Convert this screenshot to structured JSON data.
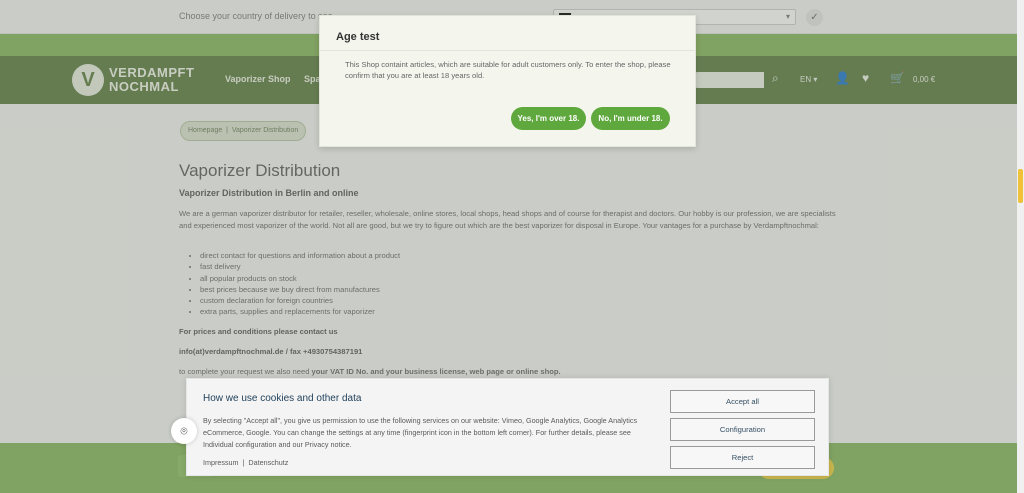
{
  "country_bar": {
    "text": "Choose your country of delivery to see",
    "confirm_icon": "check-icon"
  },
  "header": {
    "logo_text_1": "VERDAMPFT",
    "logo_text_2": "NOCHMAL",
    "logo_symbol": "V",
    "nav": [
      "Vaporizer Shop",
      "Spa"
    ],
    "language": "EN",
    "cart_total": "0,00 €"
  },
  "breadcrumb": {
    "home": "Homepage",
    "separator": "|",
    "current": "Vaporizer Distribution"
  },
  "content": {
    "title": "Vaporizer Distribution",
    "subtitle": "Vaporizer Distribution in Berlin and online",
    "intro": "We are a german vaporizer distributor for retailer, reseller, wholesale, online stores, local shops, head shops and of course for therapist and doctors. Our hobby is our profession, we are specialists and experienced most vaporizer of the world. Not all are good, but we try to figure out which are the best vaporizer for disposal in Europe. Your vantages for a purchase by Verdampftnochmal:",
    "bullets": [
      "direct contact for questions and information about a product",
      "fast delivery",
      "all popular products on stock",
      "best prices because we buy direct from manufactures",
      "custom declaration for foreign countries",
      "extra parts, supplies and replacements for vaporizer"
    ],
    "contact_heading": "For prices and conditions please contact us",
    "contact_info": "info(at)verdampftnochmal.de / fax +4930754387191",
    "request_prefix": "to complete your request we also need ",
    "request_bold": "your VAT ID No. and your business license, web page or online shop."
  },
  "age_modal": {
    "title": "Age test",
    "text": "This Shop containt articles, which are suitable for adult customers only. To enter the shop, please confirm that you are at least 18 years old.",
    "over_label": "Yes, I'm over 18.",
    "under_label": "No, I'm under 18."
  },
  "cookie_banner": {
    "title": "How we use cookies and other data",
    "text": "By selecting \"Accept all\", you give us permission to use the following services on our website: Vimeo, Google Analytics, Google Analytics eCommerce, Google. You can change the settings at any time (fingerprint icon in the bottom left corner). For further details, please see Individual configuration and our Privacy notice.",
    "impressum": "Impressum",
    "separator": "|",
    "datenschutz": "Datenschutz",
    "accept_all": "Accept all",
    "configuration": "Configuration",
    "reject": "Reject"
  },
  "colors": {
    "header_green": "#5c7a40",
    "stripe_green": "#84b35c",
    "button_green": "#5fa83d",
    "modal_bg": "#f4f6ee"
  }
}
